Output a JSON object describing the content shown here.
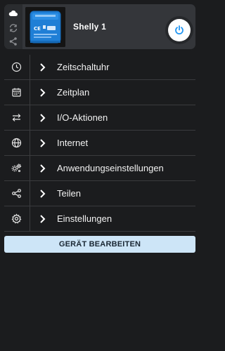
{
  "device": {
    "name": "Shelly 1",
    "power_state": "on",
    "icons": [
      "cloud-icon",
      "sync-icon",
      "share-icon"
    ]
  },
  "menu": {
    "items": [
      {
        "label": "Zeitschaltuhr",
        "icon": "clock-icon"
      },
      {
        "label": "Zeitplan",
        "icon": "calendar-icon"
      },
      {
        "label": "I/O-Aktionen",
        "icon": "arrows-exchange-icon"
      },
      {
        "label": "Internet",
        "icon": "globe-icon"
      },
      {
        "label": "Anwendungseinstellungen",
        "icon": "app-settings-icon"
      },
      {
        "label": "Teilen",
        "icon": "share-icon"
      },
      {
        "label": "Einstellungen",
        "icon": "gear-icon"
      }
    ]
  },
  "actions": {
    "edit_label": "GERÄT BEARBEITEN"
  },
  "colors": {
    "background": "#1b1c1e",
    "card": "#34363a",
    "accent": "#2196f3",
    "edit_button": "#cde5f7"
  }
}
